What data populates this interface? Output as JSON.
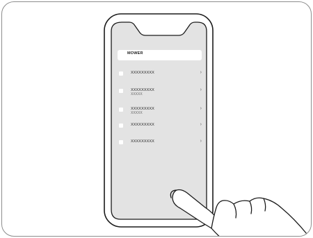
{
  "header": {
    "title": "MOWER"
  },
  "items": [
    {
      "label": "XXXXXXXXX",
      "sublabel": "",
      "chevron": "›"
    },
    {
      "label": "XXXXXXXXX",
      "sublabel": "XXXXX",
      "chevron": "›"
    },
    {
      "label": "XXXXXXXXX",
      "sublabel": "XXXXX",
      "chevron": "›"
    },
    {
      "label": "XXXXXXXXX",
      "sublabel": "",
      "chevron": "›"
    },
    {
      "label": "XXXXXXXXX",
      "sublabel": "",
      "chevron": "›"
    }
  ],
  "icons": {
    "phone": "phone-outline-icon",
    "hand": "hand-pointing-icon"
  },
  "colors": {
    "screen": "#e3e3e3",
    "outline": "#1a1a1a",
    "card": "#ffffff"
  }
}
